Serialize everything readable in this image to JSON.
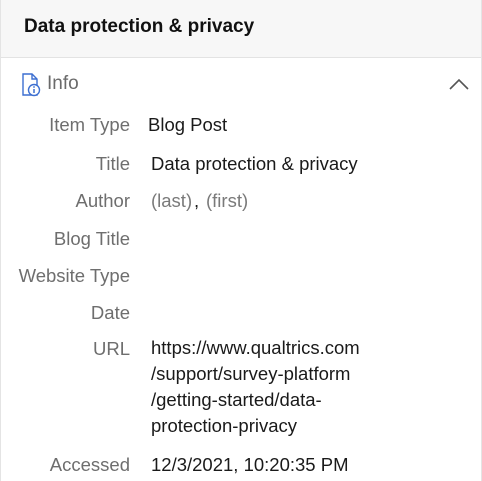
{
  "header": {
    "title": "Data protection & privacy"
  },
  "section": {
    "title": "Info",
    "icon": "document-info-icon",
    "toggle_icon": "chevron-up-icon"
  },
  "fields": {
    "item_type": {
      "label": "Item Type",
      "value": "Blog Post"
    },
    "title": {
      "label": "Title",
      "value": "Data protection & privacy"
    },
    "author": {
      "label": "Author",
      "last_placeholder": "(last)",
      "separator": ",",
      "first_placeholder": "(first)"
    },
    "blog_title": {
      "label": "Blog Title",
      "value": ""
    },
    "website_type": {
      "label": "Website Type",
      "value": ""
    },
    "date": {
      "label": "Date",
      "value": ""
    },
    "url": {
      "label": "URL",
      "lines": [
        "https://www.qualtrics.com",
        "/support/survey-platform",
        "/getting-started/data-",
        "protection-privacy"
      ]
    },
    "accessed": {
      "label": "Accessed",
      "value": "12/3/2021, 10:20:35 PM"
    }
  }
}
